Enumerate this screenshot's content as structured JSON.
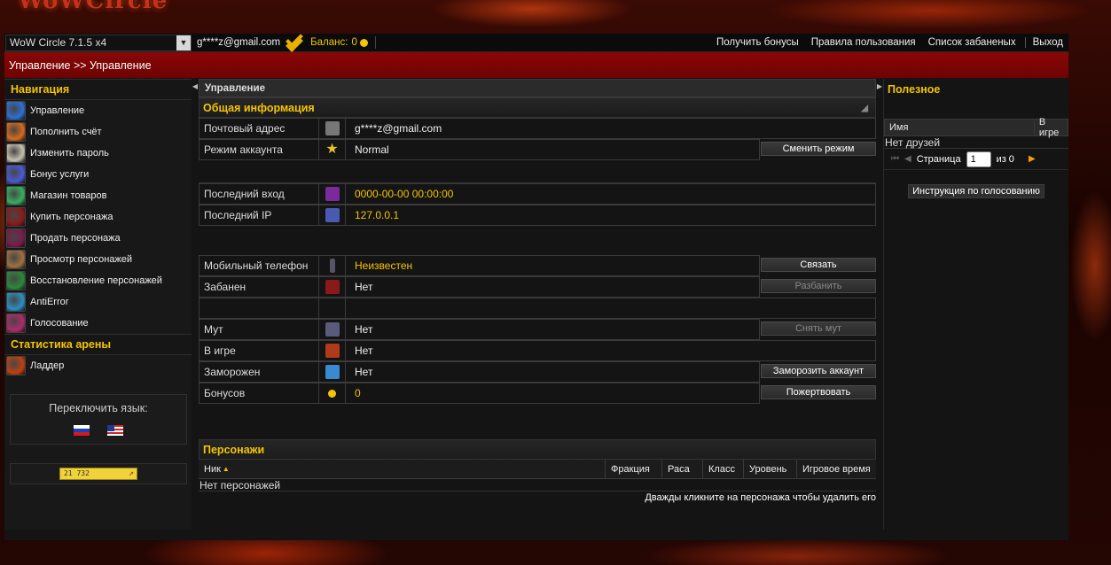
{
  "logo_text": "WoWCircle",
  "topbar": {
    "server": "WoW Circle 7.1.5 x4",
    "email": "g****z@gmail.com",
    "balance_label": "Баланс:",
    "balance_value": "0",
    "links": [
      "Получить бонусы",
      "Правила пользования",
      "Список забаненых"
    ],
    "logout": "Выход"
  },
  "breadcrumb": "Управление >> Управление",
  "sidebar": {
    "nav_title": "Навигация",
    "items": [
      {
        "label": "Управление",
        "icon": "frost-icon",
        "color": "#2d6fd6"
      },
      {
        "label": "Пополнить счёт",
        "icon": "fire-icon",
        "color": "#d86a18"
      },
      {
        "label": "Изменить пароль",
        "icon": "face-icon",
        "color": "#c7c0b0"
      },
      {
        "label": "Бонус услуги",
        "icon": "arcane-icon",
        "color": "#4a5ad8"
      },
      {
        "label": "Магазин товаров",
        "icon": "orb-icon",
        "color": "#36b060"
      },
      {
        "label": "Купить персонажа",
        "icon": "demon-icon",
        "color": "#8a1a1a"
      },
      {
        "label": "Продать персонажа",
        "icon": "shadow-icon",
        "color": "#7a1a4a"
      },
      {
        "label": "Просмотр персонажей",
        "icon": "portrait-icon",
        "color": "#a07040"
      },
      {
        "label": "Восстановление персонажей",
        "icon": "nature-icon",
        "color": "#2a8a3a"
      },
      {
        "label": "AntiError",
        "icon": "vortex-icon",
        "color": "#2a90c0"
      },
      {
        "label": "Голосование",
        "icon": "swords-icon",
        "color": "#b02a6a"
      }
    ],
    "arena_title": "Статистика арены",
    "arena_items": [
      {
        "label": "Ладдер",
        "icon": "ladder-icon",
        "color": "#c04010"
      }
    ],
    "lang_title": "Переключить язык:",
    "counter": "21 732"
  },
  "center": {
    "panel_title": "Управление",
    "general_title": "Общая информация",
    "rows": {
      "email": {
        "label": "Почтовый адрес",
        "value": "g****z@gmail.com"
      },
      "mode": {
        "label": "Режим аккаунта",
        "value": "Normal",
        "button": "Сменить режим"
      },
      "last_login": {
        "label": "Последний вход",
        "value": "0000-00-00 00:00:00"
      },
      "last_ip": {
        "label": "Последний IP",
        "value": "127.0.0.1"
      },
      "phone": {
        "label": "Мобильный телефон",
        "value": "Неизвестен",
        "button": "Связать"
      },
      "banned": {
        "label": "Забанен",
        "value": "Нет",
        "button": "Разбанить"
      },
      "mute": {
        "label": "Мут",
        "value": "Нет",
        "button": "Снять мут"
      },
      "ingame": {
        "label": "В игре",
        "value": "Нет"
      },
      "frozen": {
        "label": "Заморожен",
        "value": "Нет",
        "button": "Заморозить аккаунт"
      },
      "bonus": {
        "label": "Бонусов",
        "value": "0",
        "button": "Пожертвовать"
      }
    },
    "chars_title": "Персонажи",
    "chars_cols": [
      "Ник",
      "Фракция",
      "Раса",
      "Класс",
      "Уровень",
      "Игровое время"
    ],
    "chars_empty": "Нет персонажей",
    "chars_hint": "Дважды кликните на персонажа чтобы удалить его"
  },
  "right": {
    "title": "Полезное",
    "cols": [
      "Имя",
      "В игре"
    ],
    "empty": "Нет друзей",
    "page_label": "Страница",
    "page_value": "1",
    "page_of": "из 0",
    "vote_button": "Инструкция по голосованию"
  }
}
